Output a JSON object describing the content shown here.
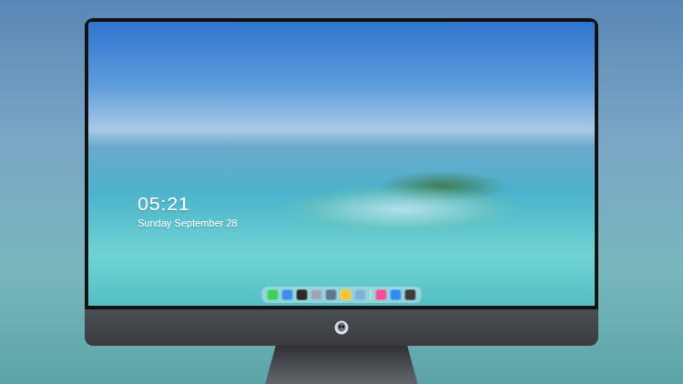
{
  "desktop": {
    "clock": {
      "time": "05:21",
      "date": "Sunday September 28"
    },
    "dock": {
      "groups": [
        {
          "items": [
            {
              "color": "#3ccf5a"
            },
            {
              "color": "#3b8df0"
            },
            {
              "color": "#2a2a2a"
            },
            {
              "color": "#9aa8b6"
            },
            {
              "color": "#5f7890"
            },
            {
              "color": "#f4c430"
            },
            {
              "color": "#7fb0d8"
            }
          ]
        },
        {
          "items": [
            {
              "color": "#f0509a"
            },
            {
              "color": "#2f8cf5"
            },
            {
              "color": "#3c3c3c"
            }
          ]
        }
      ]
    }
  }
}
